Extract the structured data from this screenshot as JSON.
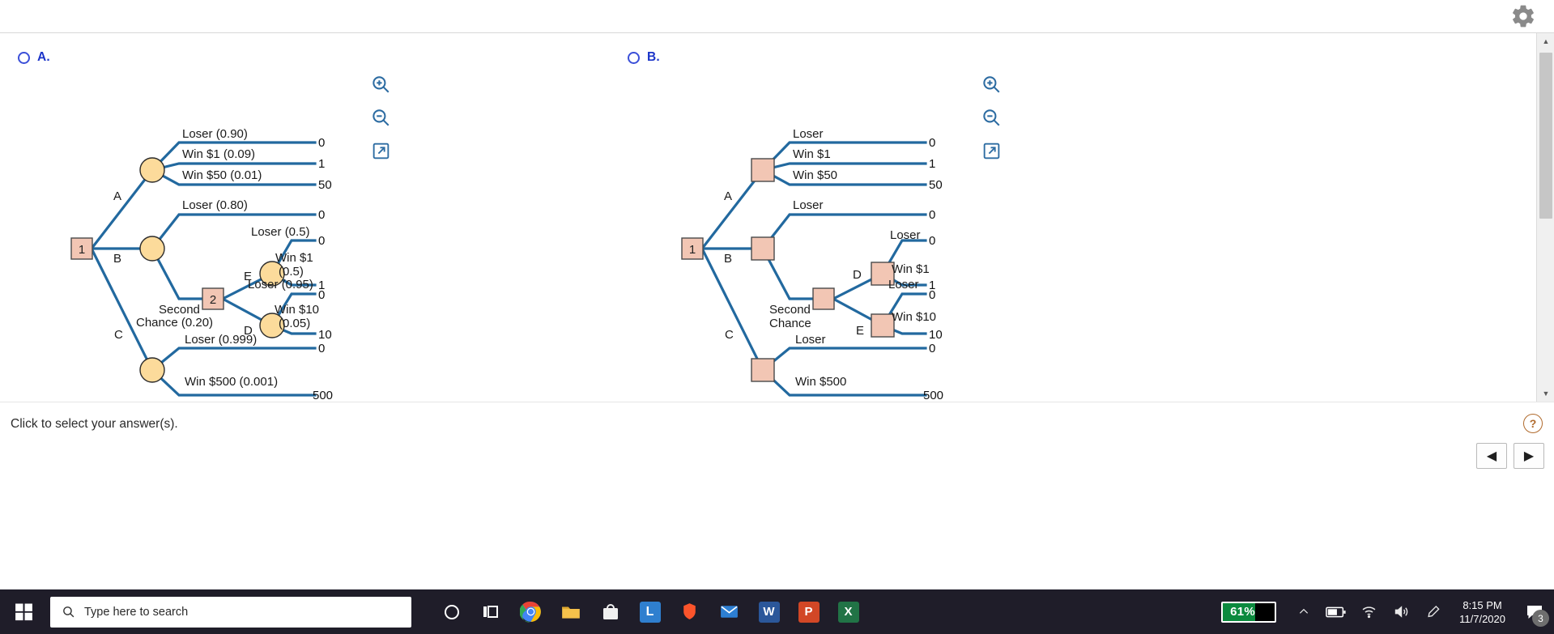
{
  "window": {
    "gear_icon": "gear-icon"
  },
  "options": [
    {
      "id": "A",
      "label": "A.",
      "radio_selected": false
    },
    {
      "id": "B",
      "label": "B.",
      "radio_selected": false
    }
  ],
  "toolbar": {
    "zoom_in_label": "zoom-in",
    "zoom_out_label": "zoom-out",
    "open_external_label": "open-in-new-window"
  },
  "footer": {
    "hint": "Click to select your answer(s).",
    "help_label": "?",
    "prev_label": "◀",
    "next_label": "▶"
  },
  "tree_a": {
    "nodes": {
      "root": "1",
      "second": "2"
    },
    "branch_labels": {
      "a": "A",
      "b": "B",
      "c": "C",
      "d": "D",
      "e": "E"
    },
    "edges": [
      "Loser (0.90)",
      "Win $1 (0.09)",
      "Win $50 (0.01)",
      "Loser (0.80)",
      "Second",
      "Chance (0.20)",
      "Loser (0.5)",
      "Win $1",
      "(0.5)",
      "Loser (0.95)",
      "Win $10",
      "(0.05)",
      "Loser (0.999)",
      "Win $500 (0.001)"
    ],
    "payoffs": [
      "0",
      "1",
      "50",
      "0",
      "0",
      "1",
      "0",
      "10",
      "0",
      "500"
    ]
  },
  "tree_b": {
    "nodes": {
      "root": "1"
    },
    "branch_labels": {
      "a": "A",
      "b": "B",
      "c": "C",
      "d": "D",
      "e": "E"
    },
    "edges": [
      "Loser",
      "Win $1",
      "Win $50",
      "Loser",
      "Second",
      "Chance",
      "Loser",
      "Win $1",
      "Loser",
      "Win $10",
      "Loser",
      "Win $500"
    ],
    "payoffs": [
      "0",
      "1",
      "50",
      "0",
      "0",
      "1",
      "0",
      "10",
      "0",
      "500"
    ]
  },
  "taskbar": {
    "search_placeholder": "Type here to search",
    "battery_percent": "61%",
    "time": "8:15 PM",
    "date": "11/7/2020",
    "notification_count": "3"
  }
}
